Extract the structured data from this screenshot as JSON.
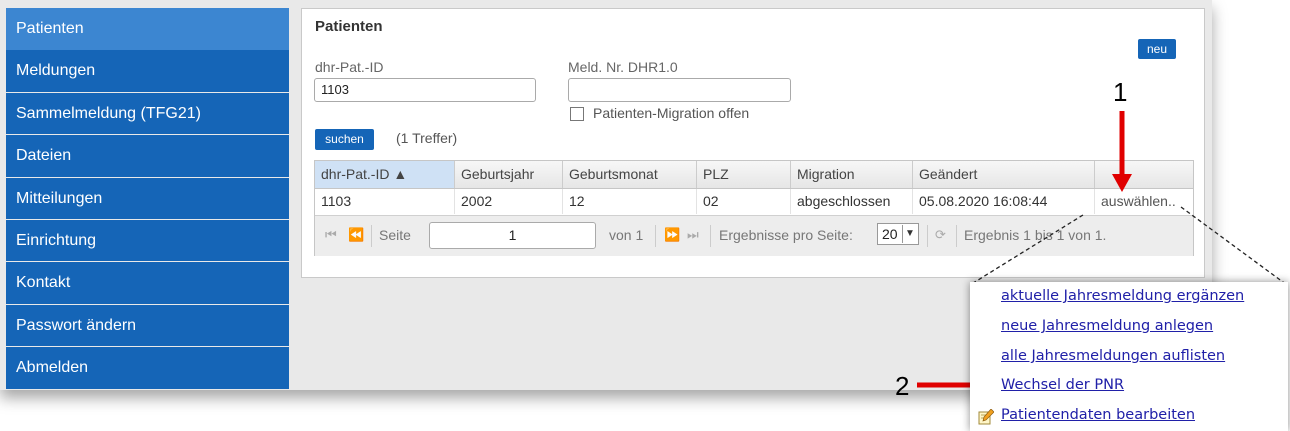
{
  "sidebar": {
    "items": [
      {
        "label": "Patienten",
        "active": true
      },
      {
        "label": "Meldungen"
      },
      {
        "label": "Sammelmeldung (TFG21)"
      },
      {
        "label": "Dateien"
      },
      {
        "label": "Mitteilungen"
      },
      {
        "label": "Einrichtung"
      },
      {
        "label": "Kontakt"
      },
      {
        "label": "Passwort ändern"
      },
      {
        "label": "Abmelden"
      }
    ]
  },
  "panel": {
    "title": "Patienten",
    "new_button": "neu",
    "pat_id_label": "dhr-Pat.-ID",
    "pat_id_value": "1103",
    "meld_label": "Meld. Nr. DHR1.0",
    "meld_value": "",
    "migration_checkbox_label": "Patienten-Migration offen",
    "search_button": "suchen",
    "hits": "(1 Treffer)"
  },
  "table": {
    "columns": [
      "dhr-Pat.-ID ▲",
      "Geburtsjahr",
      "Geburtsmonat",
      "PLZ",
      "Migration",
      "Geändert",
      ""
    ],
    "rows": [
      [
        "1103",
        "2002",
        "12",
        "02",
        "abgeschlossen",
        "05.08.2020 16:08:44",
        "auswählen.."
      ]
    ]
  },
  "pager": {
    "page_label": "Seite",
    "page_value": "1",
    "of_label": "von 1",
    "per_page_label": "Ergebnisse pro Seite:",
    "per_page_value": "20",
    "result_text": "Ergebnis 1 bis 1 von 1."
  },
  "popup": {
    "items": [
      "aktuelle Jahresmeldung ergänzen",
      "neue Jahresmeldung anlegen",
      "alle Jahresmeldungen auflisten",
      "Wechsel der PNR",
      "Patientendaten bearbeiten"
    ]
  },
  "annotations": {
    "marker_1": "1",
    "marker_2": "2",
    "arrow_color": "#e00000"
  }
}
